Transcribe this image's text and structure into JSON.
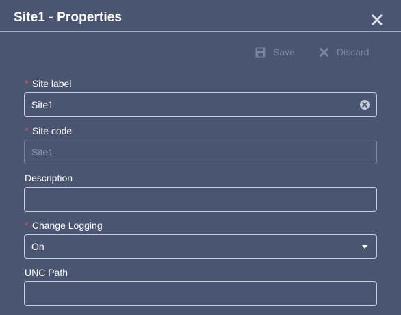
{
  "dialog": {
    "title": "Site1 - Properties"
  },
  "toolbar": {
    "save_label": "Save",
    "discard_label": "Discard"
  },
  "form": {
    "site_label": {
      "label": "Site label",
      "required": "*",
      "value": "Site1"
    },
    "site_code": {
      "label": "Site code",
      "required": "*",
      "value": "Site1"
    },
    "description": {
      "label": "Description",
      "value": ""
    },
    "change_logging": {
      "label": "Change Logging",
      "required": "*",
      "value": "On"
    },
    "unc_path": {
      "label": "UNC Path",
      "value": ""
    }
  },
  "icons": {
    "close": "close-icon",
    "save": "floppy-disk-icon",
    "discard": "x-icon",
    "clear": "circle-x-icon",
    "dropdown": "chevron-down-icon"
  },
  "colors": {
    "background": "#4a5671",
    "required": "#e0544f",
    "disabled_text": "#7c879c"
  }
}
